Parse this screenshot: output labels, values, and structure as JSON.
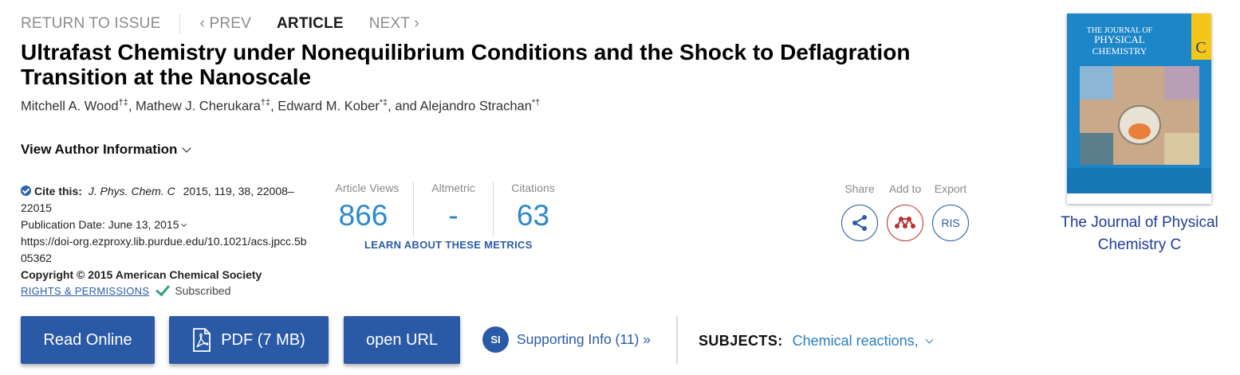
{
  "nav": {
    "return": "RETURN TO ISSUE",
    "prev": "PREV",
    "current": "ARTICLE",
    "next": "NEXT"
  },
  "article": {
    "title": "Ultrafast Chemistry under Nonequilibrium Conditions and the Shock to Deflagration Transition at the Nanoscale",
    "authors": [
      {
        "name": "Mitchell A. Wood",
        "marks": "†‡",
        "sep": ", "
      },
      {
        "name": "Mathew J. Cherukara",
        "marks": "†‡",
        "sep": ", "
      },
      {
        "name": "Edward M. Kober",
        "marks": "*‡",
        "sep": ", and "
      },
      {
        "name": "Alejandro Strachan",
        "marks": "*†",
        "sep": ""
      }
    ],
    "view_author_info": "View Author Information"
  },
  "citation": {
    "label": "Cite this:",
    "journal": "J. Phys. Chem. C",
    "details": "2015, 119, 38, 22008–22015",
    "pub_date_label": "Publication Date: June 13, 2015",
    "doi_url": "https://doi-org.ezproxy.lib.purdue.edu/10.1021/acs.jpcc.5b05362",
    "copyright": "Copyright © 2015 American Chemical Society",
    "rights": "RIGHTS & PERMISSIONS",
    "subscribed": "Subscribed"
  },
  "metrics": {
    "views_label": "Article Views",
    "views": "866",
    "altmetric_label": "Altmetric",
    "altmetric": "-",
    "citations_label": "Citations",
    "citations": "63",
    "learn": "LEARN ABOUT THESE METRICS"
  },
  "tools": {
    "share": "Share",
    "add": "Add to",
    "export": "Export",
    "ris": "RIS"
  },
  "journal": {
    "cover_title_line1": "THE JOURNAL OF",
    "cover_title_line2": "PHYSICAL",
    "cover_title_line3": "CHEMISTRY",
    "cover_letter": "C",
    "name": "The Journal of Physical Chemistry C"
  },
  "actions": {
    "read_online": "Read Online",
    "pdf": "PDF (7 MB)",
    "open_url": "open URL",
    "si_badge": "SI",
    "supporting_info": "Supporting Info (11) »",
    "subjects_label": "SUBJECTS:",
    "subject_value": "Chemical reactions,"
  },
  "colors": {
    "accent": "#2a5aa6",
    "metric_blue": "#2a8ac9",
    "cover_blue": "#1d86c8",
    "cover_yellow": "#f5c518"
  }
}
